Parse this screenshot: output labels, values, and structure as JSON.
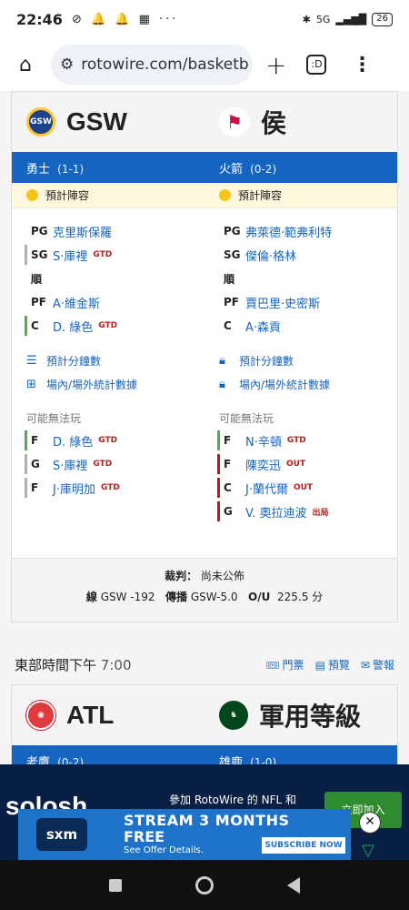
{
  "status": {
    "time": "22:46",
    "icons": "⊘ 🔔 🔔 ▦ ···",
    "net": "5G",
    "battery": "26"
  },
  "browser": {
    "url": "rotowire.com/basketb",
    "tab_count": ":D"
  },
  "game1": {
    "away": {
      "abbr": "GSW",
      "name": "勇士",
      "record": "(1-1)",
      "status": "預計陣容",
      "logo_text": "GSW"
    },
    "home": {
      "abbr": "侯",
      "name": "火箭",
      "record": "(0-2)",
      "status": "預計陣容",
      "logo_text": "⚑"
    },
    "away_lineup": [
      {
        "pos": "PG",
        "name": "克里斯保羅",
        "tag": "",
        "bar": ""
      },
      {
        "pos": "SG",
        "name": "S·庫裡",
        "tag": "GTD",
        "bar": "gray"
      },
      {
        "pos": "順",
        "name": "",
        "tag": "",
        "bar": ""
      },
      {
        "pos": "PF",
        "name": "A·維金斯",
        "tag": "",
        "bar": ""
      },
      {
        "pos": "C",
        "name": "D. 綠色",
        "tag": "GTD",
        "bar": "green"
      }
    ],
    "home_lineup": [
      {
        "pos": "PG",
        "name": "弗萊德·範弗利特",
        "tag": "",
        "bar": ""
      },
      {
        "pos": "SG",
        "name": "傑倫·格林",
        "tag": "",
        "bar": ""
      },
      {
        "pos": "順",
        "name": "",
        "tag": "",
        "bar": ""
      },
      {
        "pos": "PF",
        "name": "賈巴里·史密斯",
        "tag": "",
        "bar": ""
      },
      {
        "pos": "C",
        "name": "A·森貢",
        "tag": "",
        "bar": ""
      }
    ],
    "links": {
      "minutes": "預計分鐘數",
      "splits": "場內/場外統計數據"
    },
    "may_not_play_label": "可能無法玩",
    "away_injuries": [
      {
        "pos": "F",
        "name": "D. 綠色",
        "tag": "GTD",
        "bar": "green"
      },
      {
        "pos": "G",
        "name": "S·庫裡",
        "tag": "GTD",
        "bar": "gray"
      },
      {
        "pos": "F",
        "name": "J·庫明加",
        "tag": "GTD",
        "bar": "gray"
      }
    ],
    "home_injuries": [
      {
        "pos": "F",
        "name": "N·辛頓",
        "tag": "GTD",
        "bar": "green"
      },
      {
        "pos": "F",
        "name": "陳奕迅",
        "tag": "OUT",
        "bar": "red"
      },
      {
        "pos": "C",
        "name": "J·蘭代爾",
        "tag": "OUT",
        "bar": "red"
      },
      {
        "pos": "G",
        "name": "V. 奧拉迪波",
        "tag": "出局",
        "bar": "red"
      }
    ],
    "referee_label": "裁判：",
    "referee_value": "尚未公佈",
    "line_label": "線",
    "line_value": "GSW -192",
    "spread_label": "傳播",
    "spread_value": "GSW-5.0",
    "ou_label": "O/U",
    "ou_value": "225.5 分"
  },
  "game2_bar": {
    "time_prefix": "東部時間下午",
    "time": "7:00",
    "tickets": "門票",
    "preview": "預覽",
    "alerts": "警報"
  },
  "game2": {
    "away": {
      "abbr": "ATL",
      "name": "老鷹",
      "record": "(0-2)"
    },
    "home": {
      "abbr": "軍用等級",
      "name": "雄鹿",
      "record": "(1-0)"
    }
  },
  "promo": {
    "brand": "solosh",
    "msg": "參加 RotoWire 的 NFL 和",
    "join": "立即加入"
  },
  "ad": {
    "brand": "sxm",
    "line1": "STREAM 3 MONTHS",
    "line2": "FREE",
    "small": "See Offer Details.",
    "cta": "SUBSCRIBE NOW"
  },
  "colors": {
    "primary_blue": "#1565c0",
    "gtd_red": "#b71c1c",
    "probable_yellow": "#f5c518"
  }
}
